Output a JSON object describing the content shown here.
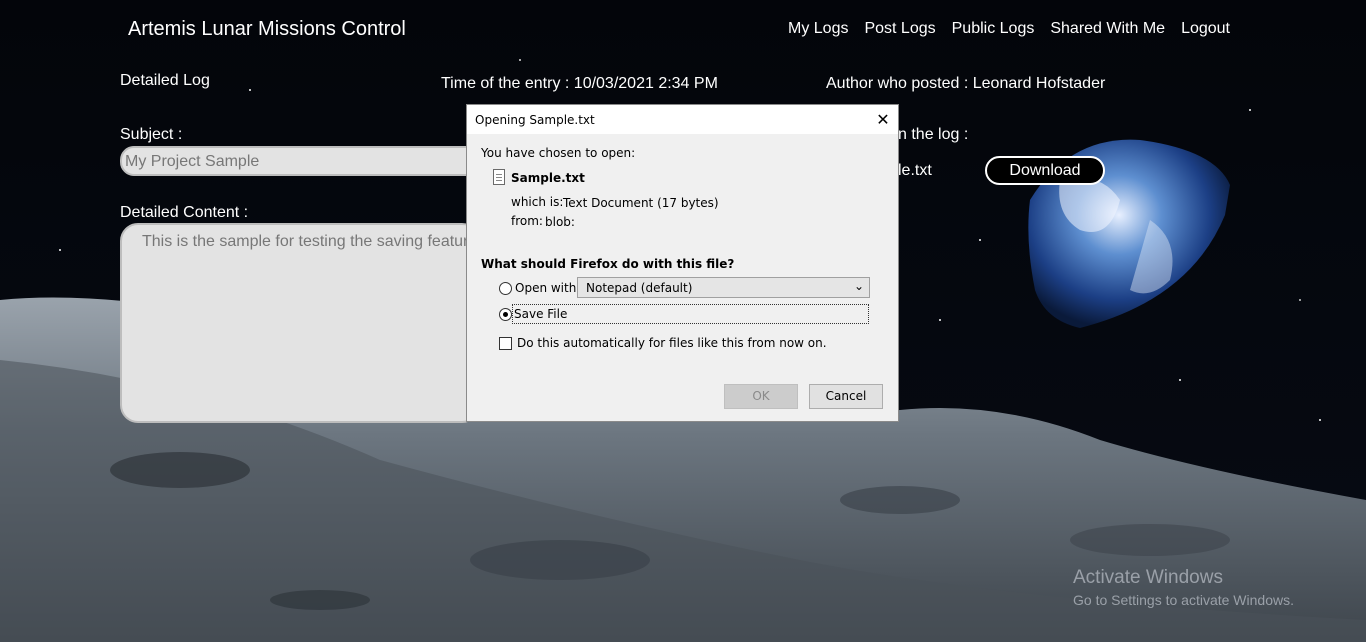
{
  "header": {
    "brand": "Artemis Lunar Missions Control",
    "nav": [
      "My Logs",
      "Post Logs",
      "Public Logs",
      "Shared With Me",
      "Logout"
    ]
  },
  "log": {
    "heading": "Detailed Log",
    "time_label": "Time of the entry : 10/03/2021 2:34 PM",
    "author_label": "Author who posted : Leonard Hofstader",
    "subject_label": "Subject :",
    "subject_value": "My Project Sample",
    "content_label": "Detailed Content :",
    "content_value": "This is the sample for testing the saving feature",
    "attachment_label_partial": "n the log :",
    "attachment_file_partial": "le.txt",
    "download_button": "Download"
  },
  "dialog": {
    "title": "Opening Sample.txt",
    "close_glyph": "✕",
    "chosen_text": "You have chosen to open:",
    "filename": "Sample.txt",
    "which_is_label": "which is:",
    "which_is_value": "Text Document (17 bytes)",
    "from_label": "from:",
    "from_value": "blob:",
    "question": "What should Firefox do with this file?",
    "open_with_label": "Open with",
    "open_with_app": "Notepad (default)",
    "save_file_label": "Save File",
    "auto_label": "Do this automatically for files like this from now on.",
    "ok_button": "OK",
    "cancel_button": "Cancel",
    "selected_option": "save-file"
  },
  "watermark": {
    "line1": "Activate Windows",
    "line2": "Go to Settings to activate Windows."
  }
}
